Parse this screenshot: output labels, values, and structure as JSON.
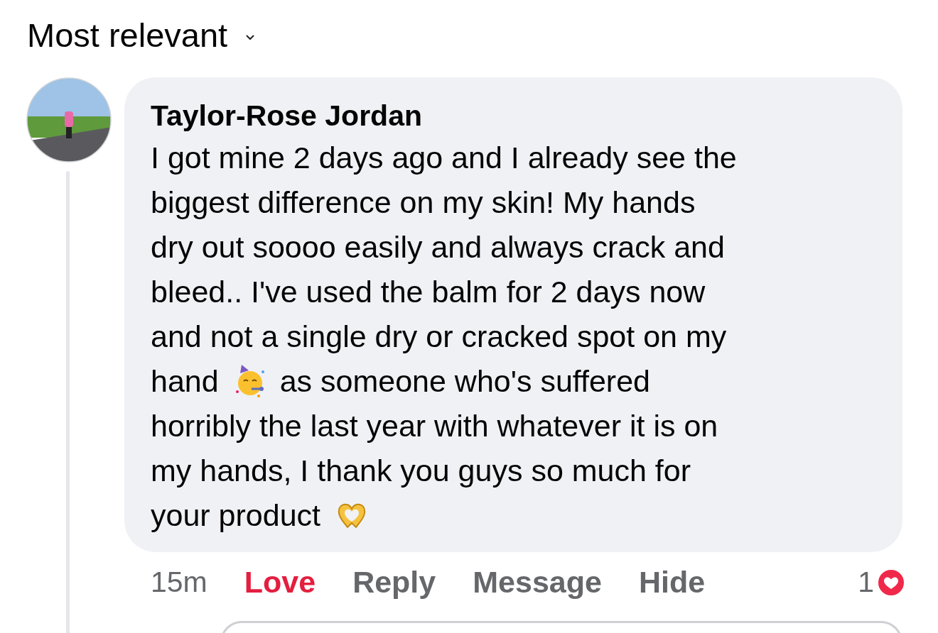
{
  "sort": {
    "label": "Most relevant"
  },
  "comment": {
    "author": "Taylor-Rose Jordan",
    "lines": [
      [
        {
          "kind": "text",
          "text": "I got mine 2 days ago and I already see the"
        }
      ],
      [
        {
          "kind": "text",
          "text": "biggest difference on my skin! My hands"
        }
      ],
      [
        {
          "kind": "text",
          "text": "dry out soooo easily and always crack and"
        }
      ],
      [
        {
          "kind": "text",
          "text": "bleed.. I've used the balm for 2 days now"
        }
      ],
      [
        {
          "kind": "text",
          "text": "and not a single dry or cracked spot on my"
        }
      ],
      [
        {
          "kind": "text",
          "text": "hand"
        },
        {
          "kind": "party-face"
        },
        {
          "kind": "text",
          "text": "as someone who's suffered"
        }
      ],
      [
        {
          "kind": "text",
          "text": "horribly the last year with whatever it is on"
        }
      ],
      [
        {
          "kind": "text",
          "text": "my hands, I thank you guys so much for"
        }
      ],
      [
        {
          "kind": "text",
          "text": "your product"
        },
        {
          "kind": "heart-hands"
        }
      ]
    ],
    "time": "15m",
    "love": {
      "label": "Love",
      "selected": true
    },
    "actions": [
      "Reply",
      "Message",
      "Hide"
    ],
    "reaction_count": "1"
  }
}
